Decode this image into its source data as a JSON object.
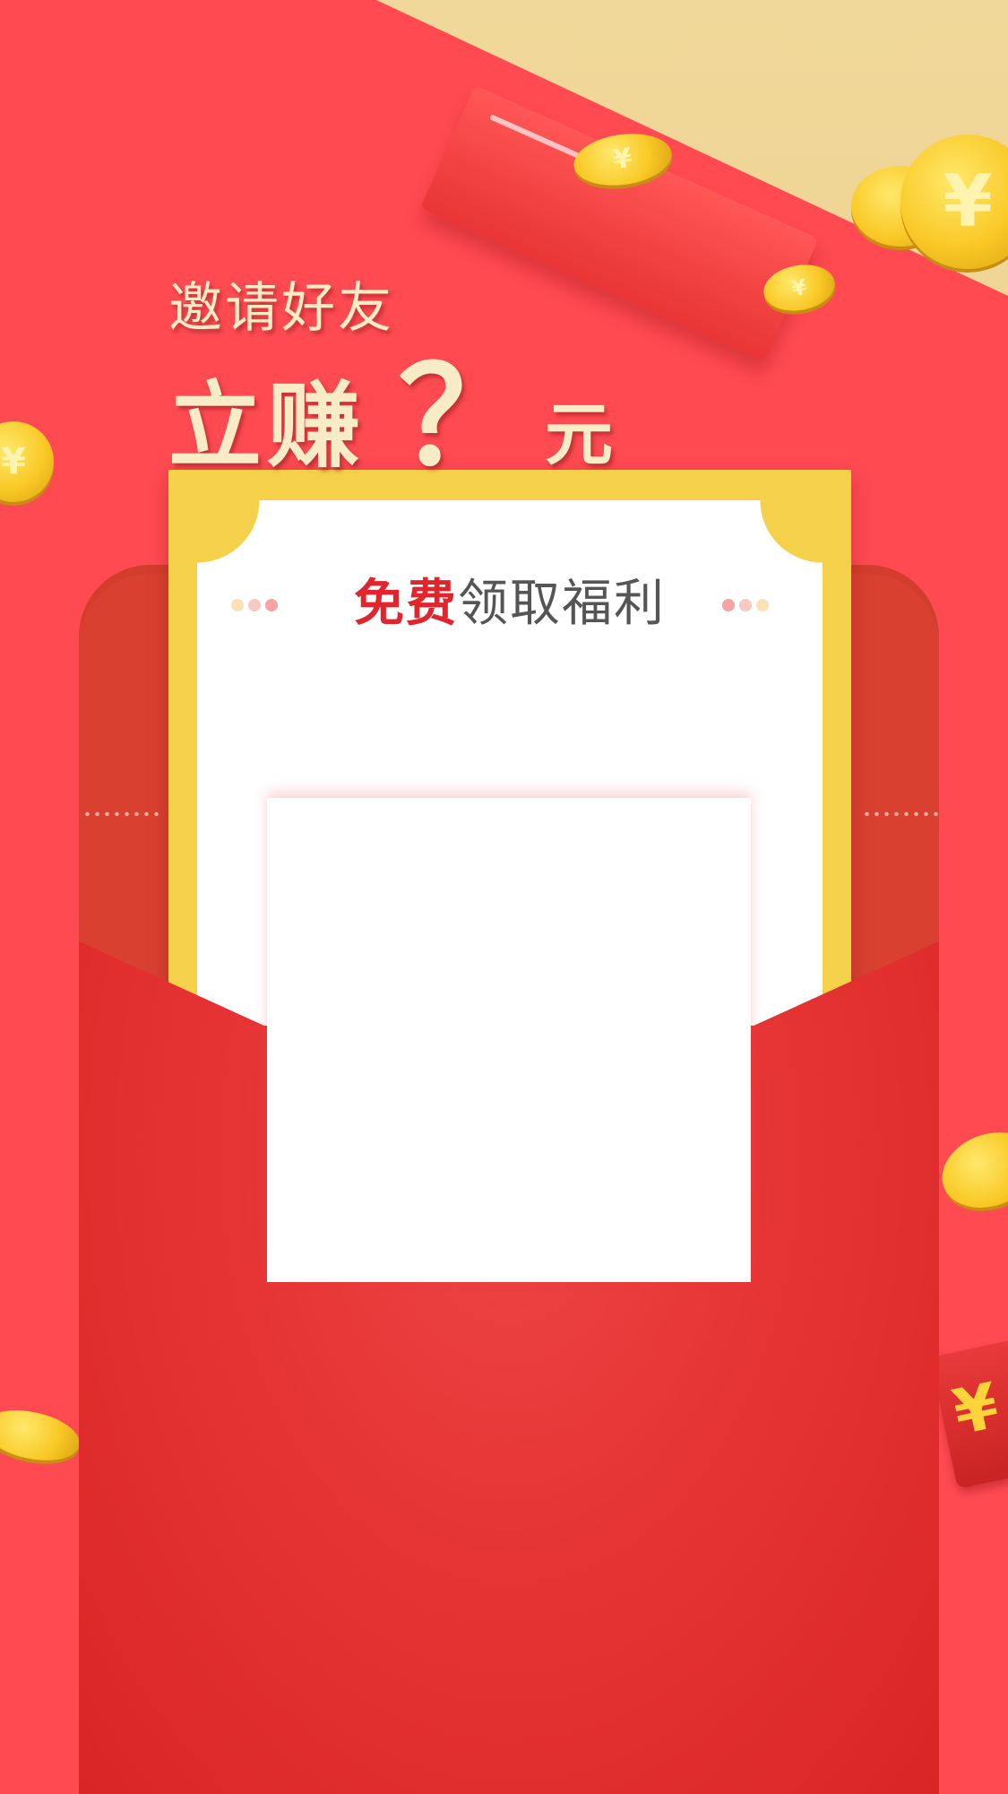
{
  "headline": {
    "line1": "邀请好友",
    "line2": "立赚",
    "amount": "？",
    "unit": "元"
  },
  "card": {
    "title_highlight": "免费",
    "title_rest": "领取福利"
  },
  "icons": {
    "coin": "yuan-coin-icon",
    "yen_symbol": "¥"
  },
  "colors": {
    "background": "#ff4a52",
    "gold_band": "#e8c47e",
    "card_frame": "#f5d04a",
    "envelope": "#e63434",
    "headline_text": "#f7ecc6",
    "title_highlight": "#e0262c"
  }
}
